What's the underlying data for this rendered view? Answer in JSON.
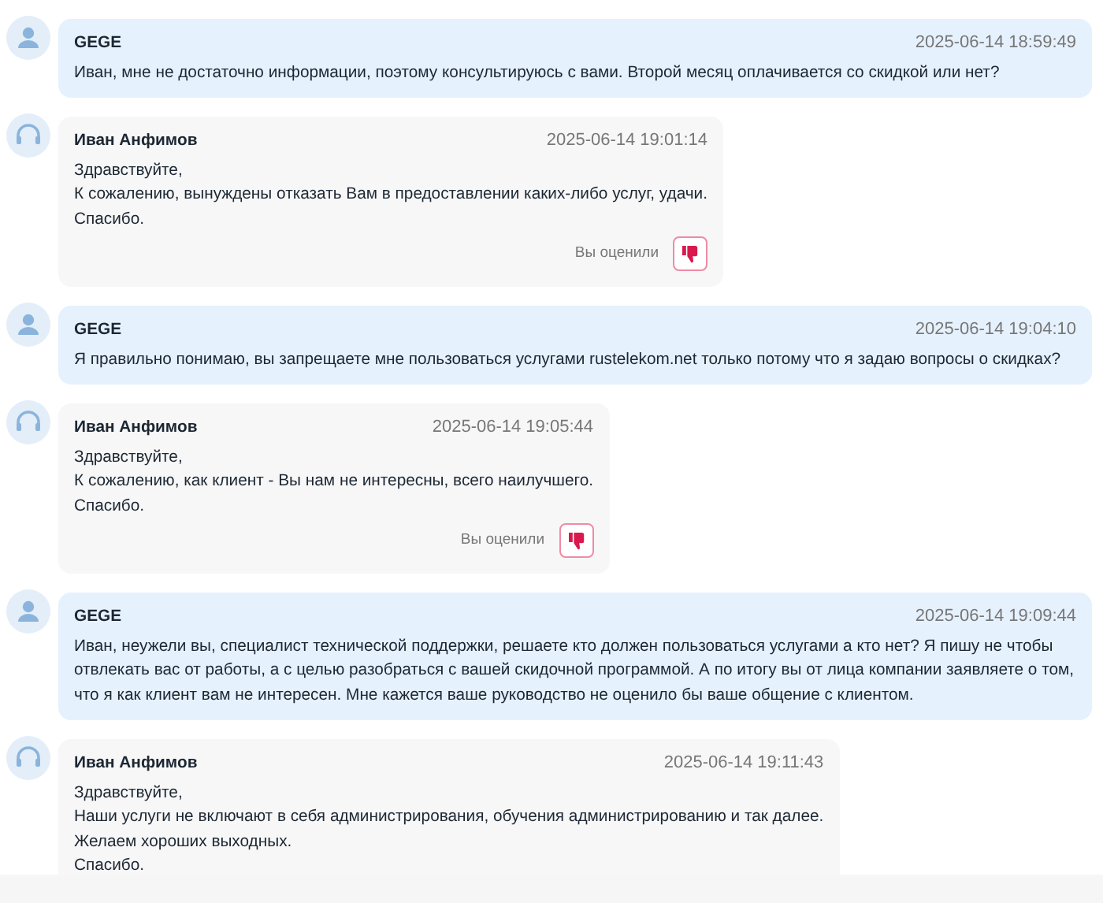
{
  "messages": [
    {
      "kind": "client",
      "author": "GEGE",
      "time": "2025-06-14 18:59:49",
      "lines": [
        "Иван, мне не достаточно информации, поэтому консультируюсь с вами. Второй месяц оплачивается со скидкой или нет?"
      ]
    },
    {
      "kind": "agent",
      "author": "Иван Анфимов",
      "time": "2025-06-14 19:01:14",
      "lines": [
        "Здравствуйте,",
        "К сожалению, вынуждены отказать Вам в предоставлении каких-либо услуг, удачи.",
        "Спасибо."
      ],
      "rating": {
        "label": "Вы оценили",
        "disliked": true
      }
    },
    {
      "kind": "client",
      "author": "GEGE",
      "time": "2025-06-14 19:04:10",
      "lines": [
        "Я правильно понимаю, вы запрещаете мне пользоваться услугами rustelekom.net только потому что я задаю вопросы о скидках?"
      ]
    },
    {
      "kind": "agent",
      "author": "Иван Анфимов",
      "time": "2025-06-14 19:05:44",
      "lines": [
        "Здравствуйте,",
        "К сожалению, как клиент - Вы нам не интересны, всего наилучшего.",
        "Спасибо."
      ],
      "rating": {
        "label": "Вы оценили",
        "disliked": true
      }
    },
    {
      "kind": "client",
      "author": "GEGE",
      "time": "2025-06-14 19:09:44",
      "lines": [
        "Иван, неужели вы, специалист технической поддержки, решаете кто должен пользоваться услугами а кто нет? Я пишу не чтобы отвлекать вас от работы, а с целью разобраться с вашей скидочной программой. А по итогу вы от лица компании заявляете о том, что я как клиент вам не интересен. Мне кажется ваше руководство не оценило бы ваше общение с клиентом."
      ]
    },
    {
      "kind": "agent",
      "author": "Иван Анфимов",
      "time": "2025-06-14 19:11:43",
      "lines": [
        "Здравствуйте,",
        "Наши услуги не включают в себя администрирования, обучения администрированию и так далее.",
        "Желаем хороших выходных.",
        "Спасибо."
      ]
    }
  ]
}
